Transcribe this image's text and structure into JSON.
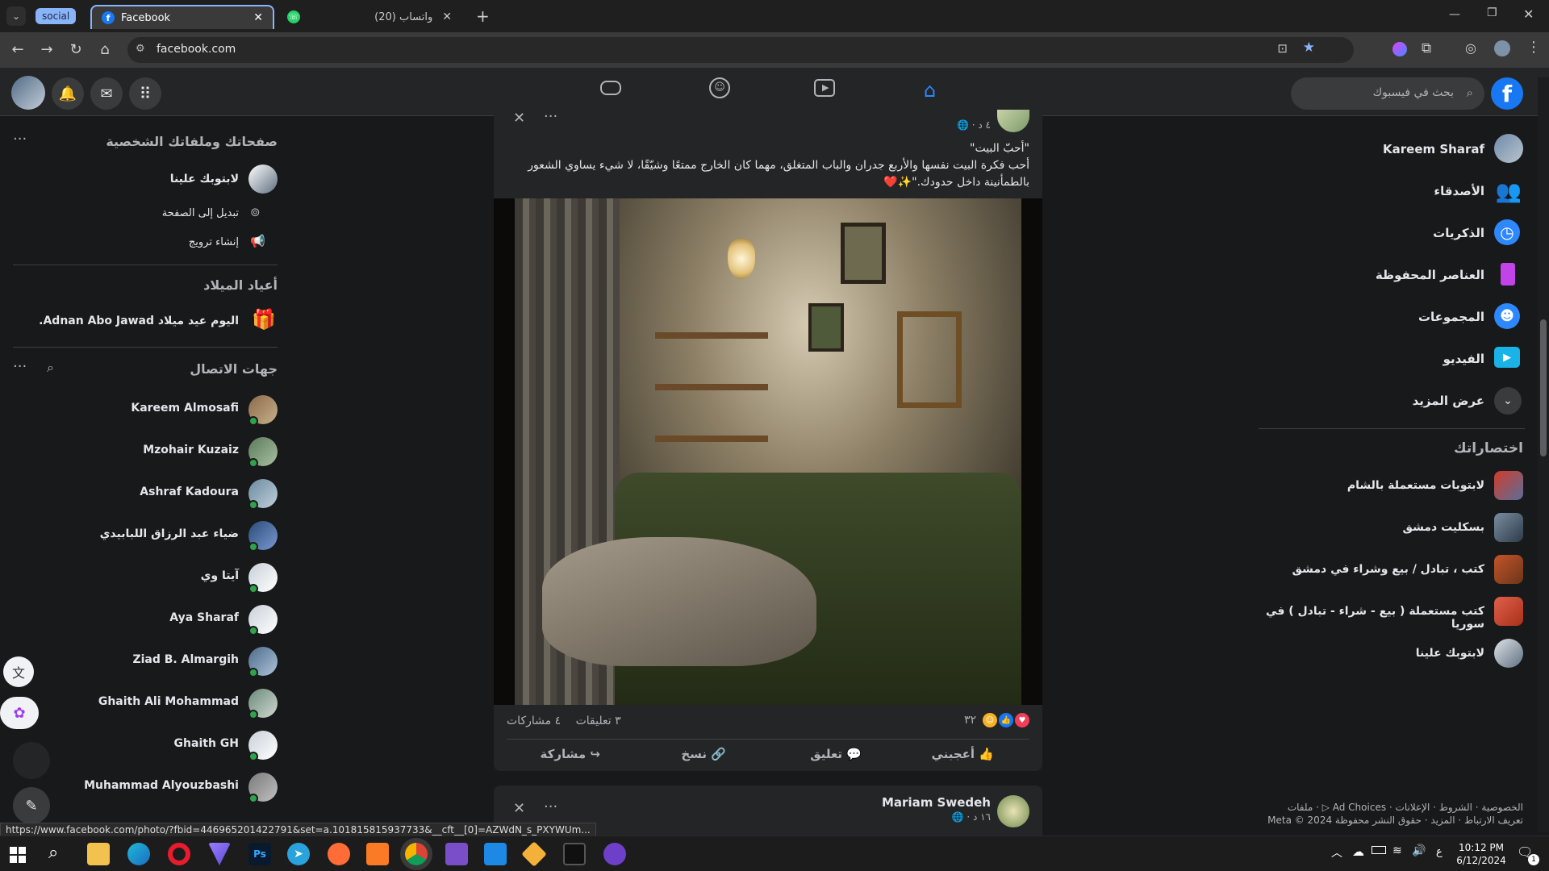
{
  "browser": {
    "tab_group_label": "social",
    "tabs": [
      {
        "title": "Facebook",
        "active": true
      },
      {
        "title": "(20) واتساب",
        "active": false
      }
    ],
    "url": "facebook.com",
    "status_url": "https://www.facebook.com/photo/?fbid=446965201422791&set=a.101815815937733&__cft__[0]=AZWdN_s_PXYWUm..."
  },
  "fb": {
    "search_placeholder": "بحث في فيسبوك",
    "brand_color": "#1877f2",
    "left_nav": {
      "user_name": "Kareem Sharaf",
      "items": [
        {
          "label": "الأصدقاء",
          "icon": "friends-icon"
        },
        {
          "label": "الذكريات",
          "icon": "memories-icon"
        },
        {
          "label": "العناصر المحفوظة",
          "icon": "saved-icon"
        },
        {
          "label": "المجموعات",
          "icon": "groups-icon"
        },
        {
          "label": "الفيديو",
          "icon": "video-icon"
        },
        {
          "label": "عرض المزيد",
          "icon": "chevron-down-icon"
        }
      ],
      "shortcuts_title": "اختصاراتك",
      "shortcuts": [
        "لابتوبات مستعملة بالشام",
        "بسكليت دمشق",
        "كتب ، تبادل / بيع وشراء في دمشق",
        "كتب مستعملة ( بيع - شراء - تبادل ) في سوريا",
        "لابتوبك علينا"
      ],
      "footer_line1": "الخصوصية · الشروط · الإعلانات · Ad Choices ▷ · ملفات",
      "footer_line2": "تعريف الارتباط · المزيد · حقوق النشر محفوظة Meta © 2024"
    },
    "right_panel": {
      "pages_title": "صفحاتك وملفاتك الشخصية",
      "page_name": "لابتوبك علينا",
      "switch_label": "تبديل إلى الصفحة",
      "promote_label": "إنشاء ترويج",
      "birthdays_title": "أعياد الميلاد",
      "birthday_text": "اليوم عيد ميلاد Adnan Abo Jawad.",
      "contacts_title": "جهات الاتصال",
      "contacts": [
        "Kareem Almosafi",
        "Mzohair Kuzaiz",
        "Ashraf Kadoura",
        "ضياء عبد الرزاق اللبابيدي",
        "آيتا وي",
        "Aya Sharaf",
        "Ziad B. Almargih",
        "Ghaith Ali Mohammad",
        "Ghaith GH",
        "Muhammad Alyouzbashi"
      ]
    },
    "post": {
      "time": "٤ د ·",
      "text_line1": "\"أحبّ البيت\"",
      "text_line2": "أحب فكرة البيت نفسها والأربع جدران والباب المتغلق، مهما كان الخارج ممتعًا وشيّقًا، لا شيء يساوي الشعور",
      "text_line3": "بالطمأنينة داخل حدودك.\"✨❤️",
      "reactions_count": "٣٢",
      "comments": "٣ تعليقات",
      "shares": "٤ مشاركات",
      "actions": [
        "أعجبني",
        "تعليق",
        "نسخ",
        "مشاركة"
      ]
    },
    "post2": {
      "author": "Mariam Swedeh",
      "time": "١٦ د ·"
    }
  },
  "taskbar": {
    "time": "10:12 PM",
    "date": "6/12/2024",
    "lang": "ع",
    "notif_count": "1"
  }
}
